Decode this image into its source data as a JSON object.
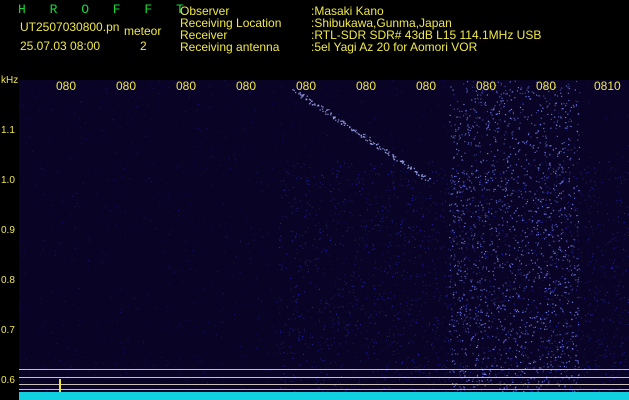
{
  "header": {
    "app_name": "H R O F F T",
    "file_name": "UT2507030800.pn",
    "mode": "meteor",
    "timestamp": "25.07.03 08:00",
    "slot": "2"
  },
  "info": {
    "labels": [
      "Observer",
      "Receiving Location",
      "Receiver",
      "Receiving antenna"
    ],
    "values": [
      ":Masaki Kano",
      ":Shibukawa,Gunma,Japan",
      ":RTL-SDR SDR# 43dB L15 114.1MHz USB",
      ":5el Yagi Az 20 for Aomori VOR"
    ]
  },
  "axis": {
    "unit": "kHz",
    "freq_labels": [
      "1.1",
      "1.0",
      "0.9",
      "0.8",
      "0.7",
      "0.6"
    ],
    "time_ticks": [
      "080",
      "080",
      "080",
      "080",
      "080",
      "080",
      "080",
      "080",
      "080",
      "0810"
    ]
  }
}
